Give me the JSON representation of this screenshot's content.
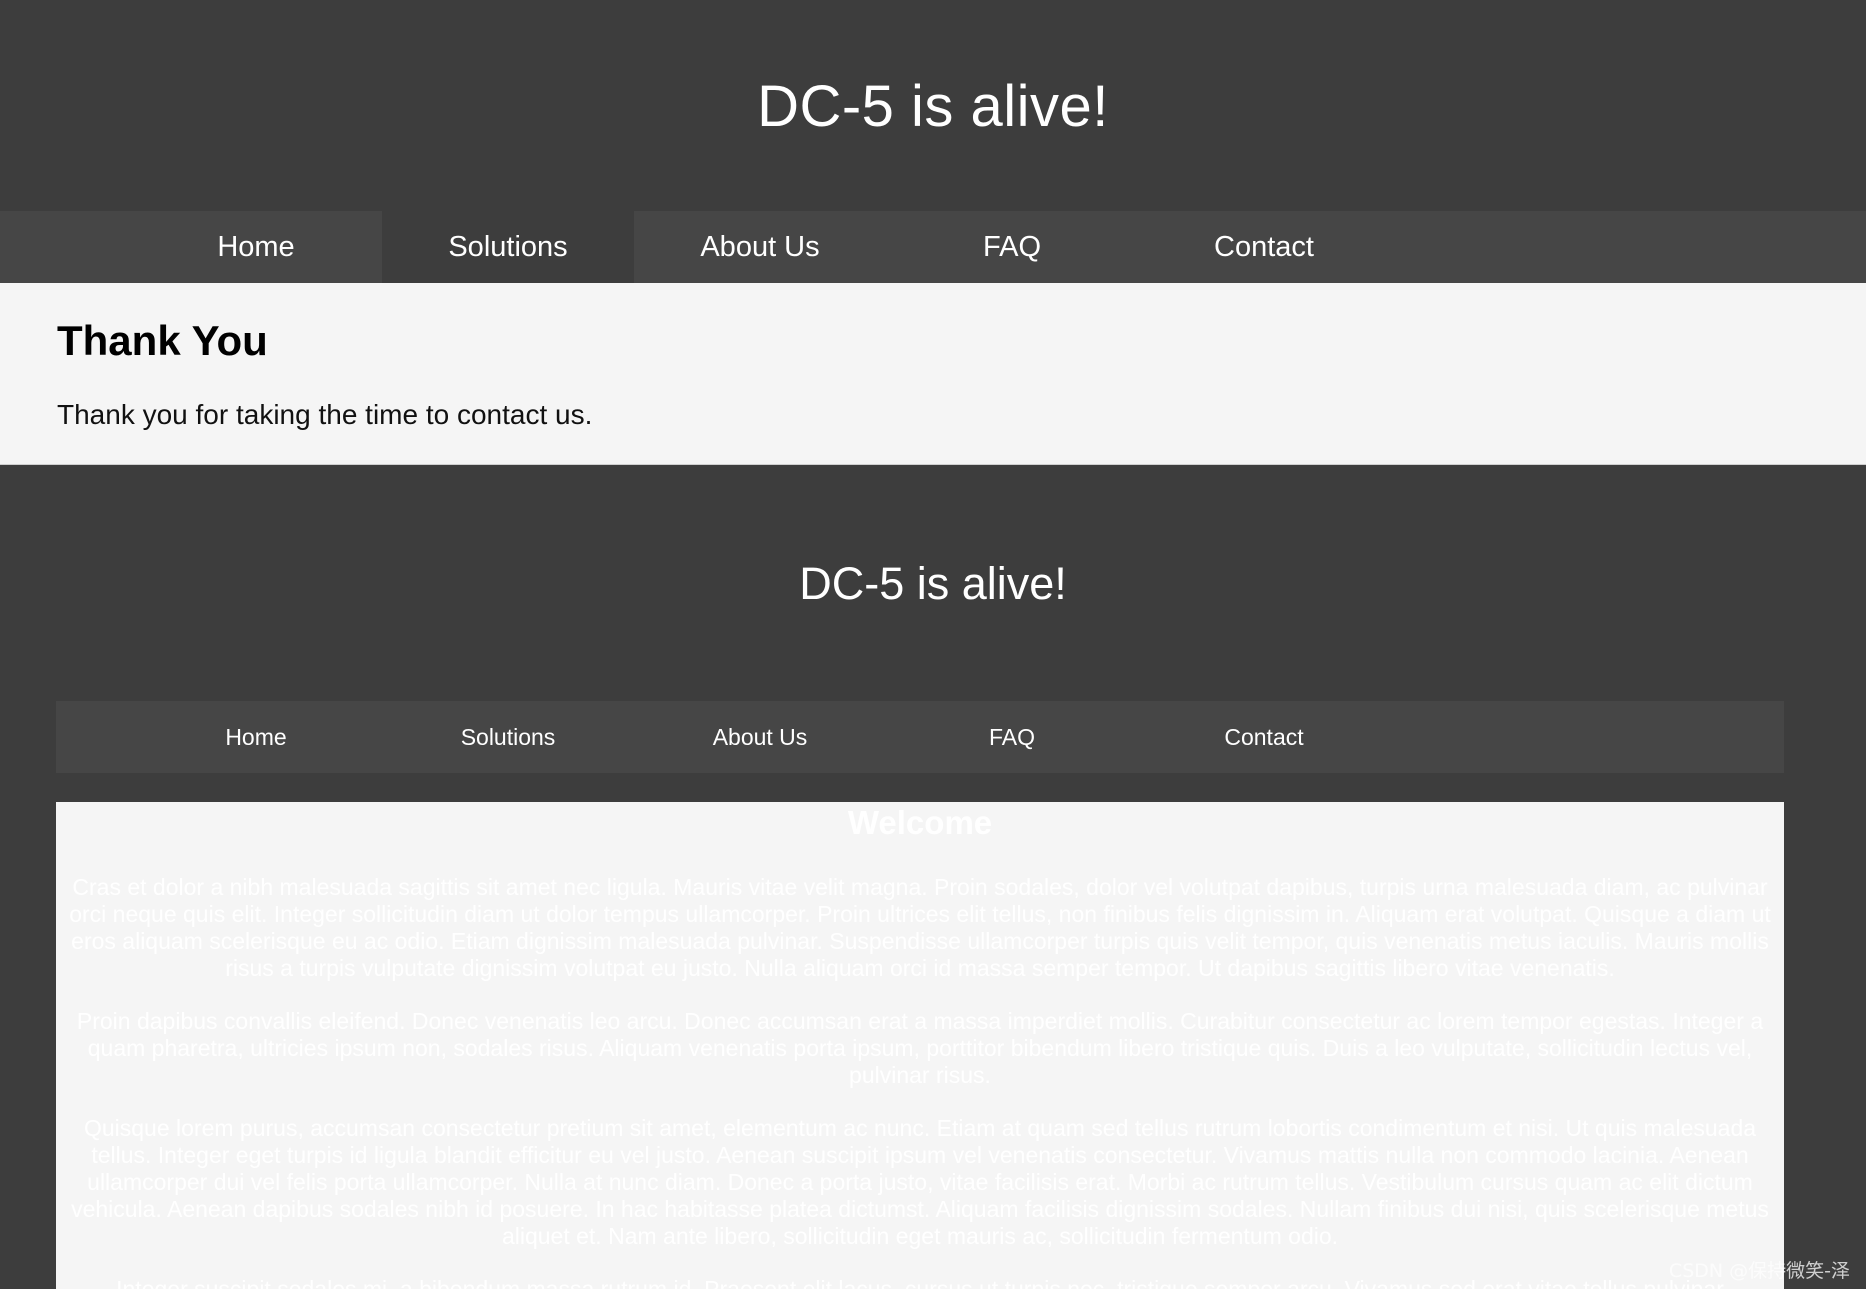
{
  "header": {
    "title": "DC-5 is alive!"
  },
  "nav": {
    "items": [
      {
        "label": "Home"
      },
      {
        "label": "Solutions"
      },
      {
        "label": "About Us"
      },
      {
        "label": "FAQ"
      },
      {
        "label": "Contact"
      }
    ],
    "active_index": 1
  },
  "content": {
    "heading": "Thank You",
    "message": "Thank you for taking the time to contact us."
  },
  "embedded_page": {
    "title": "DC-5 is alive!",
    "nav": {
      "items": [
        {
          "label": "Home"
        },
        {
          "label": "Solutions"
        },
        {
          "label": "About Us"
        },
        {
          "label": "FAQ"
        },
        {
          "label": "Contact"
        }
      ]
    },
    "main": {
      "heading": "Welcome",
      "paragraphs": [
        "Cras et dolor a nibh malesuada sagittis sit amet nec ligula. Mauris vitae velit magna. Proin sodales, dolor vel volutpat dapibus, turpis urna malesuada diam, ac pulvinar orci neque quis elit. Integer sollicitudin diam ut dolor tempus ullamcorper. Proin ultrices elit tellus, non finibus felis dignissim in. Aliquam erat volutpat. Quisque a diam ut eros aliquam scelerisque eu ac odio. Etiam dignissim malesuada pulvinar. Suspendisse ullamcorper turpis quis velit tempor, quis venenatis metus iaculis. Mauris mollis risus a turpis vulputate dignissim volutpat eu justo. Nulla aliquam orci id massa semper tempor. Ut dapibus sagittis libero vitae venenatis.",
        "Proin dapibus convallis eleifend. Donec venenatis leo arcu. Donec accumsan erat a massa imperdiet mollis. Curabitur consectetur ac lorem tempor egestas. Integer a quam pharetra, ultricies ipsum non, sodales risus. Aliquam venenatis porta ipsum, porttitor bibendum libero tristique quis. Duis a leo vulputate, sollicitudin lectus vel, pulvinar risus.",
        "Quisque lorem purus, accumsan consectetur pretium sit amet, elementum ac nunc. Etiam at quam sed tellus rutrum lobortis condimentum et nisi. Ut quis malesuada tellus. Integer eget turpis id ligula blandit efficitur eu vel justo. Aenean suscipit ipsum vel venenatis consectetur. Vivamus mattis nulla non commodo lacinia. Aenean ullamcorper dui vel felis porta ullamcorper. Nulla at nunc diam. Donec a porta justo, vitae facilisis erat. Morbi ac rutrum tellus. Vestibulum cursus quam ac elit dictum vehicula. Aenean dapibus sodales nibh id posuere. In hac habitasse platea dictumst. Aliquam facilisis dignissim sodales. Nullam finibus dui nisi, quis scelerisque metus aliquet et. Nam ante libero, sollicitudin eget mauris ac, sollicitudin fermentum odio.",
        "Integer suscipit sodales mi, a bibendum massa rutrum id. Praesent elit lacus, cursus ut turpis nec, tristique semper arcu. Vivamus sed erat vitae tellus pulvinar"
      ]
    }
  },
  "watermark": "CSDN @保持微笑-泽",
  "colors": {
    "background": "#3d3d3d",
    "nav_bar": "#464646",
    "content_bg": "#f5f5f5",
    "text_light": "#ffffff"
  }
}
